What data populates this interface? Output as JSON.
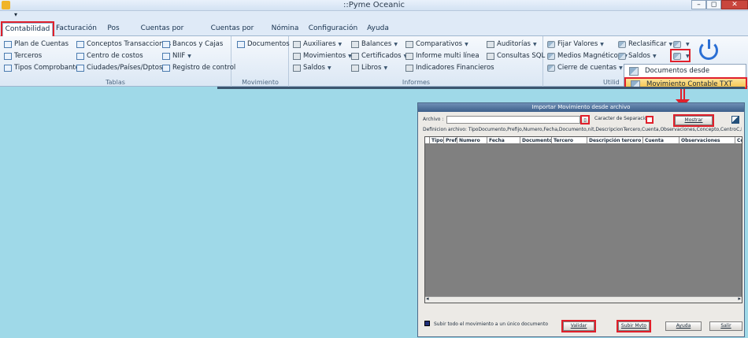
{
  "window": {
    "title": "::Pyme Oceanic"
  },
  "titlebar_buttons": {
    "minimize": "–",
    "restore": "◻",
    "close": "✕"
  },
  "qat": {
    "arrow": "▾"
  },
  "tabs": [
    {
      "label": "Contabilidad"
    },
    {
      "label": "Facturación"
    },
    {
      "label": "Pos"
    },
    {
      "label": "Cuentas por Cobrar"
    },
    {
      "label": "Cuentas por Pagar"
    },
    {
      "label": "Nómina"
    },
    {
      "label": "Configuración"
    },
    {
      "label": "Ayuda"
    }
  ],
  "ribbon": {
    "tablas": {
      "label": "Tablas",
      "items": [
        "Plan de Cuentas",
        "Terceros",
        "Tipos Comprobantes",
        "Conceptos Transacciones",
        "Centro de costos",
        "Ciudades/Países/Dptos",
        "Bancos y Cajas",
        "NIIF",
        "Registro de control"
      ]
    },
    "movimiento": {
      "label": "Movimiento",
      "items": [
        "Documentos"
      ]
    },
    "informes": {
      "label": "Informes",
      "items": [
        "Auxiliares",
        "Movimientos",
        "Saldos",
        "Balances",
        "Certificados",
        "Libros",
        "Comparativos",
        "Informe multi línea",
        "Indicadores Financieros",
        "Auditorías",
        "Consultas SQL"
      ]
    },
    "utilidades": {
      "label": "Utilid",
      "items": [
        "Fijar Valores",
        "Medios Magnéticos",
        "Cierre de cuentas",
        "Reclasificar",
        "Saldos"
      ]
    }
  },
  "dropdown": {
    "items": [
      "Documentos desde Inventarios",
      "Movimiento Contable TXT"
    ]
  },
  "dialog": {
    "title": "Importar Movimiento desde archivo",
    "archivo_label": "Archivo :",
    "archivo_value": "",
    "separador_label": "Caracter de Separación",
    "separador_value": "",
    "mostrar_label": "Mostrar",
    "definicion": "Definicion archivo: TipoDocumento,Prefijo,Numero,Fecha,Documento,nit,DescripcionTercero,Cuenta,Observaciones,Concepto,CentroC,Debitos,Creditos,Base",
    "columns": [
      "Tipo",
      "Prefi",
      "Numero",
      "Fecha",
      "Documento",
      "Tercero",
      "Descripción tercero",
      "Cuenta",
      "Observaciones",
      "Co"
    ],
    "checkbox_label": "Subir todo el movimiento a un único documento",
    "buttons": {
      "validar": "Validar",
      "subir": "Subir Mvto",
      "ayuda": "Ayuda",
      "salir": "Salir"
    }
  }
}
